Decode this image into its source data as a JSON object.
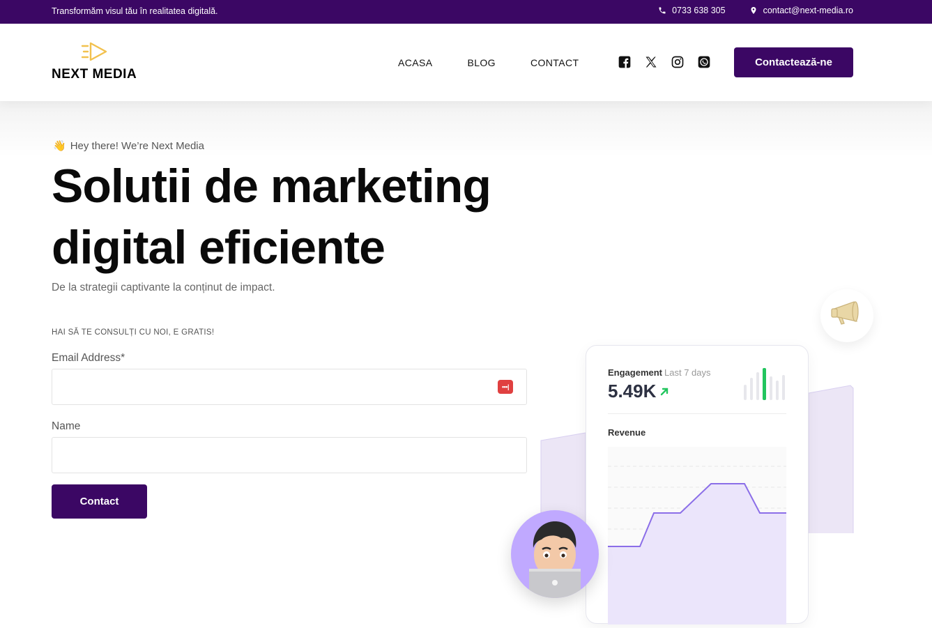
{
  "topbar": {
    "tagline": "Transformăm visul tău în realitatea digitală.",
    "phone": "0733 638 305",
    "email": "contact@next-media.ro"
  },
  "header": {
    "logo_text": "NEXT MEDIA",
    "nav": [
      "ACASA",
      "BLOG",
      "CONTACT"
    ],
    "social_icons": [
      "facebook-icon",
      "x-icon",
      "instagram-icon",
      "whatsapp-icon"
    ],
    "cta_label": "Contactează-ne"
  },
  "hero": {
    "greeting_emoji": "👋",
    "greeting": "Hey there! We’re Next Media",
    "headline": "Solutii de marketing digital eficiente",
    "subtitle": "De la strategii captivante la conținut de impact.",
    "form_heading": "HAI SĂ TE CONSULȚI CU NOI, E GRATIS!",
    "email_label": "Email Address*",
    "name_label": "Name",
    "email_value": "",
    "name_value": "",
    "submit_label": "Contact"
  },
  "stats_card": {
    "engagement_label": "Engagement",
    "engagement_period": "Last 7 days",
    "engagement_value": "5.49K",
    "revenue_label": "Revenue"
  },
  "colors": {
    "brand": "#3b0764",
    "accent_logo": "#f2c14e",
    "positive": "#22c55e",
    "chart_line": "#8b6ee8"
  }
}
